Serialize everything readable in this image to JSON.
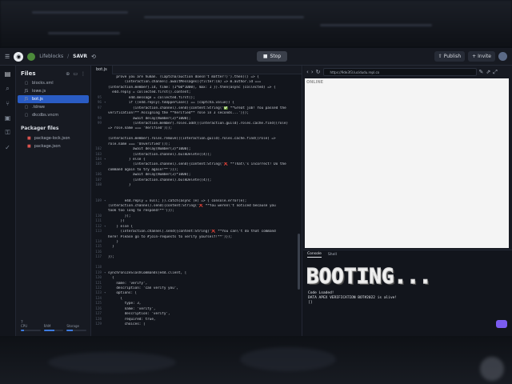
{
  "topbar": {
    "owner": "Lifeblocks",
    "separator": "/",
    "repl_name": "SAVR",
    "stop_label": "Stop",
    "publish_label": "Publish",
    "invite_label": "Invite"
  },
  "files_panel": {
    "title": "Files",
    "items": [
      {
        "name": "blocks.xml",
        "icon": "file-icon"
      },
      {
        "name": "lowe.js",
        "icon": "js-file-icon"
      },
      {
        "name": "bot.js",
        "icon": "js-file-icon",
        "selected": true
      },
      {
        "name": ".tdrwe",
        "icon": "file-icon"
      },
      {
        "name": "dkcdbs.vncm",
        "icon": "file-icon"
      }
    ],
    "packager_title": "Packager files",
    "packager_items": [
      "package-lock.json",
      "package.json"
    ],
    "resources": [
      {
        "label": "CPU",
        "fill": 0.15
      },
      {
        "label": "RAM",
        "fill": 0.55
      },
      {
        "label": "Storage",
        "fill": 0.3
      }
    ]
  },
  "editor": {
    "tab": "bot.js",
    "lines": [
      {
        "n": "",
        "f": "",
        "t": "    prove you are human. (Captcha/auction doesn't matter!)').then(() => {"
      },
      {
        "n": "",
        "f": "",
        "t": "        (interaction.channel).awaitMessages({filter:(m) => m.author.id ==="
      },
      {
        "n": "",
        "f": "",
        "t": "(interaction.member).id, time: (1*60*1000), max: 1 }).then(async (collected) => {"
      },
      {
        "n": "",
        "f": "",
        "t": "  e4d.reply = collected.first().content;"
      },
      {
        "n": "95",
        "f": "",
        "t": "          e4d.message = collected.first();"
      },
      {
        "n": "96",
        "f": "▾",
        "t": "          if ((e4d.reply).toUpperCase() == (captcha.value)) {"
      },
      {
        "n": "97",
        "f": "",
        "t": "            (interaction.channel).send({content:String('✅ **Great job! You passed the"
      },
      {
        "n": "",
        "f": "",
        "t": "verification!** Assigning the **Verified** role in 3 seconds...')});"
      },
      {
        "n": "98",
        "f": "",
        "t": "            await delay(Number(3)*1000);"
      },
      {
        "n": "99",
        "f": "",
        "t": "            (interaction.member).roles.add(((interaction.guild).roles.cache.find((role)"
      },
      {
        "n": "",
        "f": "",
        "t": "=> role.name === 'Verified')));"
      },
      {
        "n": "",
        "f": "",
        "t": ""
      },
      {
        "n": "",
        "f": "",
        "t": "(interaction.member).roles.remove(((interaction.guild).roles.cache.find((role) =>"
      },
      {
        "n": "",
        "f": "",
        "t": "role.name === 'Unverified')));"
      },
      {
        "n": "102",
        "f": "",
        "t": "            await delay(Number(3)*1000);"
      },
      {
        "n": "103",
        "f": "",
        "t": "            (interaction.channel).bulkDelete((4));"
      },
      {
        "n": "104",
        "f": "▾",
        "t": "          } else {"
      },
      {
        "n": "105",
        "f": "",
        "t": "            (interaction.channel).send({content:String('❌ **That\\'s incorrect! Do the"
      },
      {
        "n": "",
        "f": "",
        "t": "command again to try again!**')});"
      },
      {
        "n": "106",
        "f": "",
        "t": "            await delay(Number(3)*1000);"
      },
      {
        "n": "107",
        "f": "",
        "t": "            (interaction.channel).bulkDelete((4));"
      },
      {
        "n": "108",
        "f": "",
        "t": "          }"
      },
      {
        "n": "",
        "f": "",
        "t": ""
      },
      {
        "n": "",
        "f": "",
        "t": ""
      },
      {
        "n": "109",
        "f": "▾",
        "t": "        e4d.reply = null; }).catch(async (e) => { console.error(e);"
      },
      {
        "n": "",
        "f": "",
        "t": "(interaction.channel).send({content:String('❌ **You weren\\'t noticed because you"
      },
      {
        "n": "",
        "f": "",
        "t": "took too long to respond!**')});"
      },
      {
        "n": "110",
        "f": "",
        "t": "        });"
      },
      {
        "n": "111",
        "f": "",
        "t": "      })"
      },
      {
        "n": "112",
        "f": "▾",
        "t": "    } else {"
      },
      {
        "n": "113",
        "f": "",
        "t": "      (interaction.channel).send({content:String('❌ **You can\\'t do that command"
      },
      {
        "n": "",
        "f": "",
        "t": "here! Please go to #join-requests to verify yourself!**')});"
      },
      {
        "n": "114",
        "f": "",
        "t": "    }"
      },
      {
        "n": "115",
        "f": "",
        "t": "  }"
      },
      {
        "n": "116",
        "f": "",
        "t": ""
      },
      {
        "n": "117",
        "f": "",
        "t": "});"
      },
      {
        "n": "",
        "f": "",
        "t": ""
      },
      {
        "n": "118",
        "f": "",
        "t": ""
      },
      {
        "n": "119",
        "f": "▾",
        "t": "synchronizeSlashCommands(e4d.client, ["
      },
      {
        "n": "120",
        "f": "",
        "t": "  {"
      },
      {
        "n": "121",
        "f": "",
        "t": "    name: 'verify',"
      },
      {
        "n": "122",
        "f": "",
        "t": "    description: 'can verify you',"
      },
      {
        "n": "123",
        "f": "▾",
        "t": "    options: ["
      },
      {
        "n": "124",
        "f": "",
        "t": "      {"
      },
      {
        "n": "125",
        "f": "",
        "t": "        type: 3,"
      },
      {
        "n": "126",
        "f": "",
        "t": "        name: 'verify',"
      },
      {
        "n": "127",
        "f": "",
        "t": "        description: 'verify',"
      },
      {
        "n": "128",
        "f": "",
        "t": "        required: true,"
      },
      {
        "n": "129",
        "f": "",
        "t": "        choices: ["
      }
    ]
  },
  "webview": {
    "url": "https://9de3f3.lucidudu.repl.co",
    "content_text": "ONLINE"
  },
  "console": {
    "tabs": [
      "Console",
      "Shell"
    ],
    "banner": "BOOTING...",
    "lines": [
      "Code Loaded!",
      "DATA APEX VERIFICATION BOT#2022 is alive!",
      "[]"
    ]
  }
}
